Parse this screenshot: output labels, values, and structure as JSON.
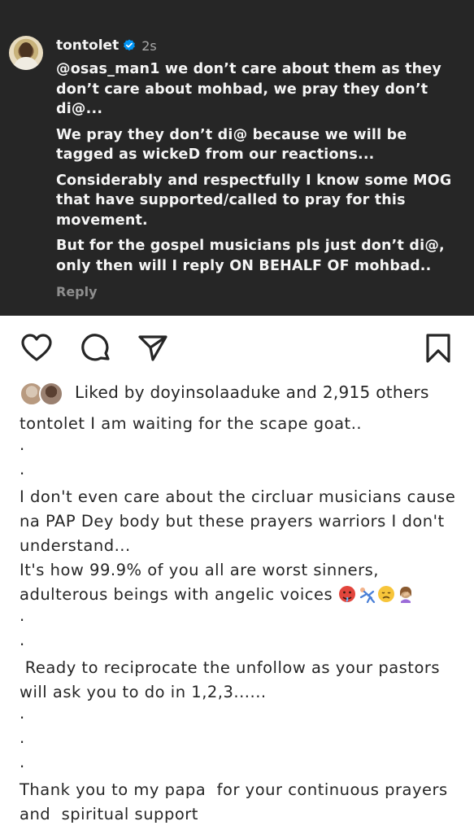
{
  "comment": {
    "username": "tontolet",
    "time": "2s",
    "paragraphs": [
      "@osas_man1 we don’t care about them as they don’t care about mohbad, we pray they don’t di@...",
      "We pray they don’t di@ because we will be tagged as wickeD from our reactions...",
      "Considerably and respectfully I know some MOG that have supported/called to pray for this movement.",
      "But for the gospel musicians pls just don’t di@, only then will I reply ON BEHALF OF  mohbad.."
    ],
    "reply_label": "Reply"
  },
  "actions": {
    "like_icon": "heart-icon",
    "comment_icon": "comment-icon",
    "share_icon": "send-icon",
    "save_icon": "bookmark-icon"
  },
  "likes": {
    "text": "Liked by doyinsolaaduke and 2,915 others"
  },
  "caption": {
    "line1": "tontolet I am waiting for the scape goat..",
    "dot1": ".",
    "dot2": ".",
    "line2": "I don't even care about the circluar musicians cause",
    "line3": "na PAP Dey body but these prayers warriors I don't",
    "line4": "understand...",
    "line5": "It's how 99.9% of you all are worst sinners,",
    "line6": "adulterous beings with angelic voices",
    "emojis": [
      "hot-face-emoji",
      "person-cartwheeling-emoji",
      "disappointed-face-emoji",
      "woman-facepalming-emoji"
    ],
    "dot3": ".",
    "dot4": ".",
    "line7": " Ready to reciprocate the unfollow as your pastors",
    "line8": "will ask you to do in 1,2,3......",
    "dot5": ".",
    "dot6": ".",
    "dot7": ".",
    "line9": "Thank you to my papa  for your continuous prayers",
    "line10": "and  spiritual support"
  },
  "colors": {
    "card_bg": "#262626",
    "verified": "#0095f6",
    "text_dark": "#262626"
  }
}
